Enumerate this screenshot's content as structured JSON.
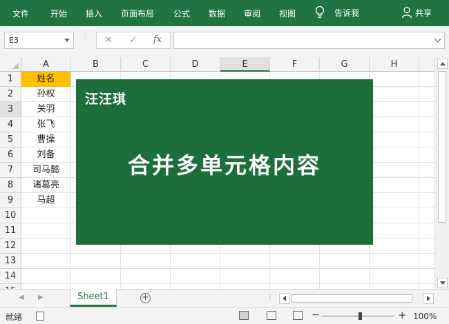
{
  "ribbon": {
    "tabs": [
      "文件",
      "开始",
      "插入",
      "页面布局",
      "公式",
      "数据",
      "审阅",
      "视图"
    ],
    "tell_me": "告诉我",
    "share": "共享"
  },
  "formula_bar": {
    "name_box": "E3",
    "cancel_icon": "✕",
    "enter_icon": "✓",
    "fx_label": "fx",
    "formula": ""
  },
  "grid": {
    "columns": [
      "A",
      "B",
      "C",
      "D",
      "E",
      "F",
      "G",
      "H"
    ],
    "rows": [
      "1",
      "2",
      "3",
      "4",
      "5",
      "6",
      "7",
      "8",
      "9",
      "10",
      "11",
      "12",
      "13",
      "14",
      "15"
    ],
    "column_a": [
      "姓名",
      "孙权",
      "关羽",
      "张飞",
      "曹操",
      "刘备",
      "司马懿",
      "诸葛亮",
      "马超"
    ],
    "header_fill": "#ffc000"
  },
  "banner": {
    "author": "汪汪琪",
    "title": "合并多单元格内容",
    "fill": "#1e6e3c"
  },
  "sheets": {
    "active": "Sheet1"
  },
  "status": {
    "ready": "就绪",
    "zoom": "100%"
  },
  "colors": {
    "accent": "#217346"
  }
}
